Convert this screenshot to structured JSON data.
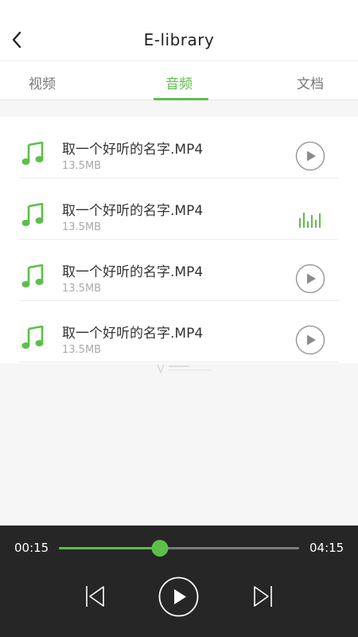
{
  "header": {
    "title": "E-library"
  },
  "tabs": [
    {
      "label": "视频"
    },
    {
      "label": "音频"
    },
    {
      "label": "文档"
    }
  ],
  "active_tab": 1,
  "items": [
    {
      "name": "取一个好听的名字.MP4",
      "size": "13.5MB",
      "state": "paused"
    },
    {
      "name": "取一个好听的名字.MP4",
      "size": "13.5MB",
      "state": "playing"
    },
    {
      "name": "取一个好听的名字.MP4",
      "size": "13.5MB",
      "state": "paused"
    },
    {
      "name": "取一个好听的名字.MP4",
      "size": "13.5MB",
      "state": "paused"
    }
  ],
  "player": {
    "current_time": "00:15",
    "total_time": "04:15",
    "progress": 0.42
  },
  "colors": {
    "accent": "#5cbf4a",
    "player_bg": "#262626",
    "text": "#333333",
    "muted": "#aaaaaa"
  },
  "icons": {
    "back": "chevron-left-icon",
    "item": "music-note-icon",
    "play": "play-circle-icon",
    "equalizer": "equalizer-icon",
    "previous": "skip-previous-icon",
    "next": "skip-next-icon"
  }
}
